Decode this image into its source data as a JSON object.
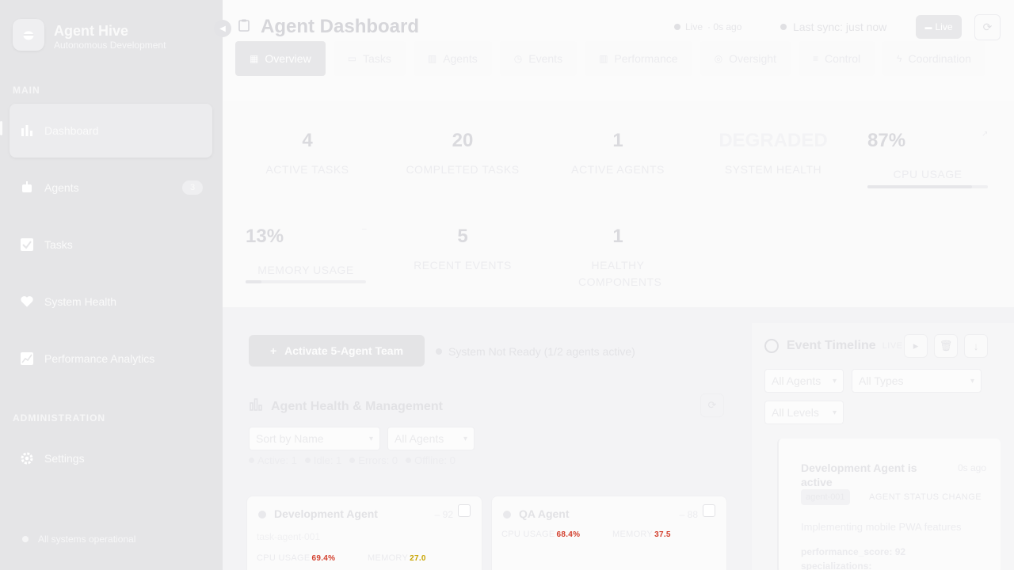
{
  "brand": {
    "name": "Agent Hive",
    "subtitle": "Autonomous Development",
    "logo_icon": "bee-icon"
  },
  "sidebar": {
    "main_label": "MAIN",
    "admin_label": "ADMINISTRATION",
    "items": [
      {
        "label": "Dashboard",
        "icon": "dashboard-icon",
        "active": true
      },
      {
        "label": "Agents",
        "icon": "robot-icon",
        "badge": "3"
      },
      {
        "label": "Tasks",
        "icon": "checkbox-icon"
      },
      {
        "label": "System Health",
        "icon": "heart-icon"
      },
      {
        "label": "Performance Analytics",
        "icon": "chart-icon"
      }
    ],
    "admin_items": [
      {
        "label": "Settings",
        "icon": "gear-icon"
      }
    ],
    "status_text": "All systems operational"
  },
  "header": {
    "title": "Agent Dashboard",
    "live_text": "Live",
    "live_ago": "· 0s ago",
    "sync_text": "Last sync: just now",
    "live_button": "Live",
    "tabs": [
      {
        "label": "Overview",
        "icon": "grid-icon",
        "active": true
      },
      {
        "label": "Tasks",
        "icon": "clipboard-icon"
      },
      {
        "label": "Agents",
        "icon": "bars-icon"
      },
      {
        "label": "Events",
        "icon": "clock-icon"
      },
      {
        "label": "Performance",
        "icon": "bars-icon"
      },
      {
        "label": "Oversight",
        "icon": "check-circle-icon"
      },
      {
        "label": "Control",
        "icon": "sliders-icon"
      },
      {
        "label": "Coordination",
        "icon": "lightning-icon"
      }
    ]
  },
  "stats": {
    "active_tasks": {
      "value": "4",
      "label": "ACTIVE TASKS"
    },
    "completed_tasks": {
      "value": "20",
      "label": "COMPLETED TASKS"
    },
    "active_agents": {
      "value": "1",
      "label": "ACTIVE AGENTS"
    },
    "system_health": {
      "value": "DEGRADED",
      "label": "SYSTEM HEALTH"
    },
    "cpu_usage": {
      "value": "87%",
      "label": "CPU USAGE",
      "level": 0.87
    },
    "memory_usage": {
      "value": "13%",
      "label": "MEMORY USAGE",
      "level": 0.13
    },
    "recent_events": {
      "value": "5",
      "label": "RECENT EVENTS"
    },
    "healthy_components": {
      "value": "1",
      "label": "HEALTHY COMPONENTS"
    }
  },
  "agents_section": {
    "activate_button": "Activate 5-Agent Team",
    "not_ready": "System Not Ready (1/2 agents active)",
    "title": "Agent Health & Management",
    "sort_select": "Sort by Name",
    "filter_select": "All Agents",
    "chips": [
      "Active: 1",
      "Idle: 1",
      "Errors: 0",
      "Offline: 0"
    ],
    "cards": [
      {
        "name": "Development Agent",
        "score": "– 92",
        "task": "task-agent-001",
        "cpu_label": "CPU USAGE",
        "cpu_value": "69.4%",
        "mem_label": "MEMORY",
        "mem_value": "27.0"
      },
      {
        "name": "QA Agent",
        "score": "– 88",
        "cpu_label": "CPU USAGE",
        "cpu_value": "68.4%",
        "mem_label": "MEMORY",
        "mem_value": "37.5"
      }
    ]
  },
  "timeline": {
    "title": "Event Timeline",
    "live": "LIVE",
    "agent_filter": "All Agents",
    "type_filter": "All Types",
    "level_filter": "All Levels",
    "event": {
      "title": "Development Agent is active",
      "time": "0s ago",
      "agent_tag": "agent-001",
      "type_tag": "AGENT STATUS CHANGE",
      "description": "Implementing mobile PWA features",
      "meta1": "performance_score: 92",
      "meta2": "specializations:"
    }
  }
}
